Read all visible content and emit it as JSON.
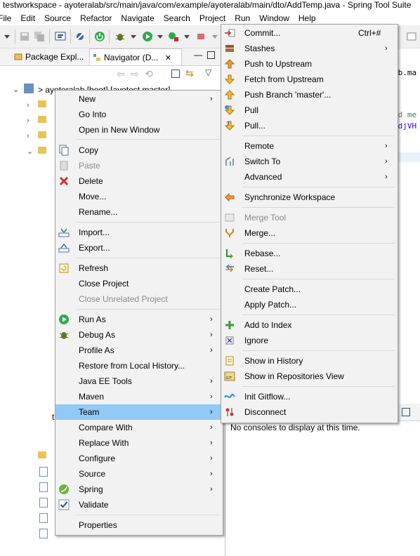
{
  "window": {
    "title": "testworkspace - ayoteralab/src/main/java/com/example/ayoteralab/main/dto/AddTemp.java - Spring Tool Suite"
  },
  "menubar": [
    {
      "label": "File"
    },
    {
      "label": "Edit"
    },
    {
      "label": "Source"
    },
    {
      "label": "Refactor"
    },
    {
      "label": "Navigate"
    },
    {
      "label": "Search"
    },
    {
      "label": "Project"
    },
    {
      "label": "Run"
    },
    {
      "label": "Window"
    },
    {
      "label": "Help"
    }
  ],
  "views": {
    "tab_package_explorer": "Package Expl...",
    "tab_navigator": "Navigator (D...",
    "tree_root": "> ayoteralab [boot] [ayotest master]",
    "tree_items": [
      "t"
    ]
  },
  "console": {
    "message": "No consoles to display at this time."
  },
  "editor": {
    "snippets": [
      "ab.ma",
      "ed me",
      "sdjVH"
    ]
  },
  "context_menu": {
    "items": [
      {
        "label": "New",
        "submenu": true
      },
      {
        "label": "Go Into"
      },
      {
        "label": "Open in New Window"
      },
      {
        "label": "Copy",
        "icon": "copy-icon"
      },
      {
        "label": "Paste",
        "icon": "paste-icon",
        "disabled": true
      },
      {
        "label": "Delete",
        "icon": "delete-icon"
      },
      {
        "label": "Move..."
      },
      {
        "label": "Rename..."
      },
      {
        "label": "Import...",
        "icon": "import-icon"
      },
      {
        "label": "Export...",
        "icon": "export-icon"
      },
      {
        "label": "Refresh",
        "icon": "refresh-icon"
      },
      {
        "label": "Close Project"
      },
      {
        "label": "Close Unrelated Project",
        "disabled": true
      },
      {
        "label": "Run As",
        "icon": "run-icon",
        "submenu": true
      },
      {
        "label": "Debug As",
        "icon": "debug-icon",
        "submenu": true
      },
      {
        "label": "Profile As",
        "submenu": true
      },
      {
        "label": "Restore from Local History..."
      },
      {
        "label": "Java EE Tools",
        "submenu": true
      },
      {
        "label": "Maven",
        "submenu": true
      },
      {
        "label": "Team",
        "submenu": true,
        "highlighted": true
      },
      {
        "label": "Compare With",
        "submenu": true
      },
      {
        "label": "Replace With",
        "submenu": true
      },
      {
        "label": "Configure",
        "submenu": true
      },
      {
        "label": "Source",
        "submenu": true
      },
      {
        "label": "Spring",
        "icon": "spring-icon",
        "submenu": true
      },
      {
        "label": "Validate",
        "icon": "validate-icon"
      },
      {
        "label": "Properties"
      }
    ]
  },
  "team_menu": {
    "items": [
      {
        "label": "Commit...",
        "accelerator": "Ctrl+#",
        "icon": "commit-icon"
      },
      {
        "label": "Stashes",
        "icon": "stash-icon",
        "submenu": true
      },
      {
        "label": "Push to Upstream",
        "icon": "push-icon"
      },
      {
        "label": "Fetch from Upstream",
        "icon": "fetch-icon"
      },
      {
        "label": "Push Branch 'master'...",
        "icon": "push-branch-icon"
      },
      {
        "label": "Pull",
        "icon": "pull-icon"
      },
      {
        "label": "Pull...",
        "icon": "pull-dialog-icon"
      },
      {
        "label": "Remote",
        "submenu": true
      },
      {
        "label": "Switch To",
        "icon": "switch-icon",
        "submenu": true
      },
      {
        "label": "Advanced",
        "submenu": true
      },
      {
        "label": "Synchronize Workspace",
        "icon": "synchronize-icon"
      },
      {
        "label": "Merge Tool",
        "icon": "merge-tool-icon",
        "disabled": true
      },
      {
        "label": "Merge...",
        "icon": "merge-icon"
      },
      {
        "label": "Rebase...",
        "icon": "rebase-icon"
      },
      {
        "label": "Reset...",
        "icon": "reset-icon"
      },
      {
        "label": "Create Patch..."
      },
      {
        "label": "Apply Patch..."
      },
      {
        "label": "Add to Index",
        "icon": "add-to-index-icon"
      },
      {
        "label": "Ignore",
        "icon": "ignore-icon"
      },
      {
        "label": "Show in History",
        "icon": "history-icon"
      },
      {
        "label": "Show in Repositories View",
        "icon": "git-repo-icon"
      },
      {
        "label": "Init Gitflow...",
        "icon": "gitflow-icon"
      },
      {
        "label": "Disconnect",
        "icon": "disconnect-icon"
      }
    ]
  }
}
